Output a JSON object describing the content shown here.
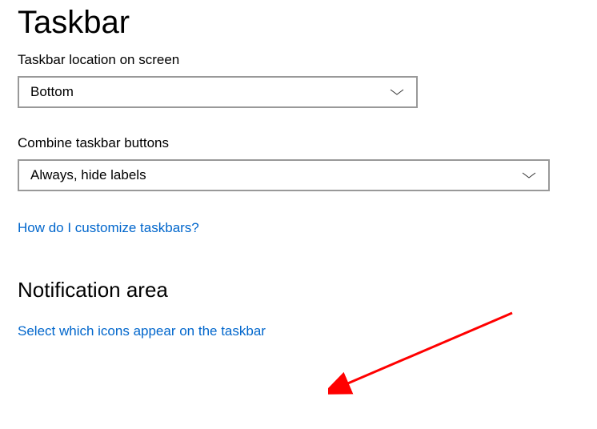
{
  "page": {
    "title": "Taskbar"
  },
  "location": {
    "label": "Taskbar location on screen",
    "value": "Bottom"
  },
  "combine": {
    "label": "Combine taskbar buttons",
    "value": "Always, hide labels"
  },
  "help_link": "How do I customize taskbars?",
  "notification": {
    "section_title": "Notification area",
    "select_icons_link": "Select which icons appear on the taskbar"
  }
}
